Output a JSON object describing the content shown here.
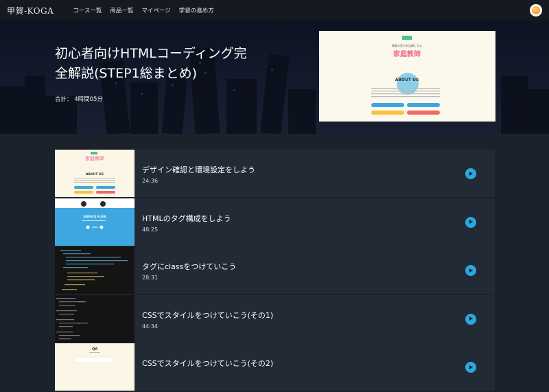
{
  "nav": {
    "brand": "甲賀-KOGA",
    "links": [
      "コース一覧",
      "商品一覧",
      "マイページ",
      "学習の進め方"
    ]
  },
  "hero": {
    "title_line1": "初心者向けHTMLコーディング完",
    "title_line2": "全解説(STEP1総まとめ)",
    "total": "合計： 4時間05分",
    "thumb": {
      "caption": "素敵な貴方を笑顔にする",
      "logo": "家庭教師",
      "section": "ABOUT US"
    }
  },
  "lessons": [
    {
      "title": "デザイン確認と環境設定をしよう",
      "duration": "24:36",
      "thumb": "cream"
    },
    {
      "title": "HTMLのタグ構成をしよう",
      "duration": "48:25",
      "thumb": "blue"
    },
    {
      "title": "タグにclassをつけていこう",
      "duration": "28:31",
      "thumb": "code"
    },
    {
      "title": "CSSでスタイルをつけていこう(その1)",
      "duration": "44:34",
      "thumb": "code"
    },
    {
      "title": "CSSでスタイルをつけていこう(その2)",
      "duration": "",
      "thumb": "cream"
    }
  ],
  "lesson_thumb_text": {
    "about": "ABOUT US",
    "service": "SERVICE FLOW",
    "qa": "QA"
  },
  "colors": {
    "accent": "#2ba8e0",
    "logo_pink": "#ee6b8f",
    "logo_green": "#4cc08d",
    "logo_yellow": "#f5c542",
    "logo_blue": "#3ea7e0"
  }
}
